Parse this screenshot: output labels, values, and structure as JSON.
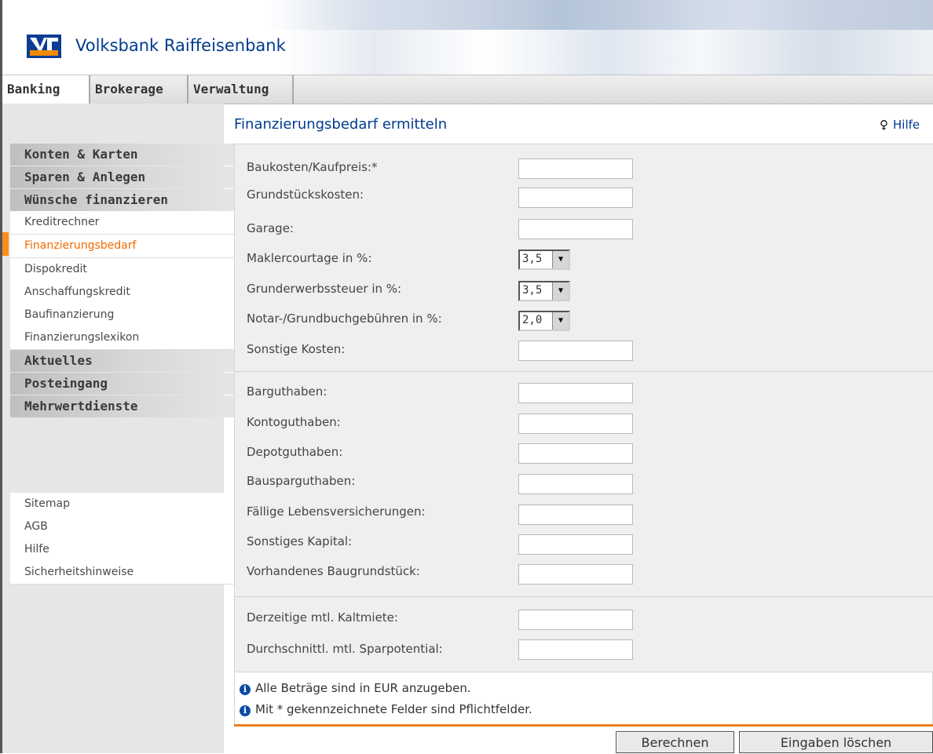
{
  "brand": {
    "name": "Volksbank Raiffeisenbank",
    "logo": "vr-logo"
  },
  "tabs": [
    {
      "label": "Banking",
      "active": true
    },
    {
      "label": "Brokerage",
      "active": false
    },
    {
      "label": "Verwaltung",
      "active": false
    }
  ],
  "sidebar": {
    "sections": [
      {
        "label": "Konten & Karten"
      },
      {
        "label": "Sparen & Anlegen"
      },
      {
        "label": "Wünsche finanzieren"
      }
    ],
    "sub_items": [
      {
        "label": "Kreditrechner"
      },
      {
        "label": "Finanzierungsbedarf",
        "active": true
      },
      {
        "label": "Dispokredit"
      },
      {
        "label": "Anschaffungskredit"
      },
      {
        "label": "Baufinanzierung"
      },
      {
        "label": "Finanzierungslexikon"
      }
    ],
    "sections_after": [
      {
        "label": "Aktuelles"
      },
      {
        "label": "Posteingang"
      },
      {
        "label": "Mehrwertdienste"
      }
    ],
    "footer_links": [
      {
        "label": "Sitemap"
      },
      {
        "label": "AGB"
      },
      {
        "label": "Hilfe"
      },
      {
        "label": "Sicherheitshinweise"
      }
    ]
  },
  "page": {
    "title": "Finanzierungsbedarf ermitteln",
    "help_label": "Hilfe"
  },
  "form": {
    "costs": {
      "baukosten": {
        "label": "Baukosten/Kaufpreis:*",
        "value": ""
      },
      "grundstueck": {
        "label": "Grundstückskosten:",
        "value": ""
      },
      "garage": {
        "label": "Garage:",
        "value": ""
      },
      "makler": {
        "label": "Maklercourtage in %:",
        "value": "3,5"
      },
      "grunderwerb": {
        "label": "Grunderwerbssteuer in %:",
        "value": "3,5"
      },
      "notar": {
        "label": "Notar-/Grundbuchgebühren in %:",
        "value": "2,0"
      },
      "sonstige": {
        "label": "Sonstige Kosten:",
        "value": ""
      }
    },
    "assets": {
      "barguthaben": {
        "label": "Barguthaben:",
        "value": ""
      },
      "kontoguthaben": {
        "label": "Kontoguthaben:",
        "value": ""
      },
      "depotguthaben": {
        "label": "Depotguthaben:",
        "value": ""
      },
      "bausparguthaben": {
        "label": "Bausparguthaben:",
        "value": ""
      },
      "lebensversicherungen": {
        "label": "Fällige Lebensversicherungen:",
        "value": ""
      },
      "kapital": {
        "label": "Sonstiges Kapital:",
        "value": ""
      },
      "baugrundstueck": {
        "label": "Vorhandenes Baugrundstück:",
        "value": ""
      }
    },
    "budget": {
      "kaltmiete": {
        "label": "Derzeitige mtl. Kaltmiete:",
        "value": ""
      },
      "sparpotential": {
        "label": "Durchschnittl. mtl. Sparpotential:",
        "value": ""
      }
    }
  },
  "notes": [
    "Alle Beträge sind in EUR anzugeben.",
    "Mit * gekennzeichnete Felder sind Pflichtfelder."
  ],
  "buttons": {
    "calculate": "Berechnen",
    "clear": "Eingaben löschen"
  },
  "colors": {
    "brand_blue": "#003b8e",
    "accent_orange": "#f07d1e"
  }
}
